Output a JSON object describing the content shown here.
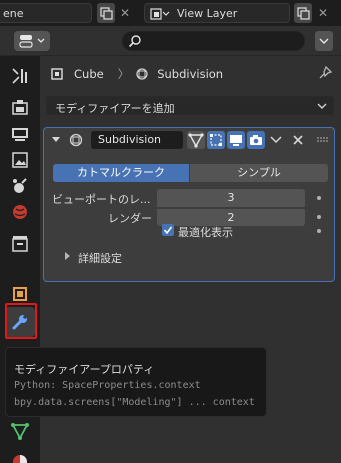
{
  "topbar": {
    "scene_value": "ene",
    "view_layer_value": "View Layer"
  },
  "breadcrumb": {
    "object": "Cube",
    "separator": "〉",
    "modifier": "Subdivision"
  },
  "add_modifier_label": "モディファイアーを追加",
  "modifier": {
    "name": "Subdivision",
    "type_options": [
      "カトマルクラーク",
      "シンプル"
    ],
    "selected_type": "カトマルクラーク",
    "viewport_label": "ビューポートのレ...",
    "viewport_value": "3",
    "render_label": "レンダー",
    "render_value": "2",
    "optimal_display_label": "最適化表示",
    "optimal_display_checked": true,
    "advanced_label": "詳細設定"
  },
  "tooltip": {
    "title": "モディファイアープロパティ",
    "python": "Python: SpaceProperties.context",
    "path": "bpy.data.screens[\"Modeling\"] ... context"
  },
  "colors": {
    "accent": "#4772b3",
    "highlight_border": "#e01818",
    "panel_bg": "#303030",
    "header_bg": "#1d1d1d"
  }
}
